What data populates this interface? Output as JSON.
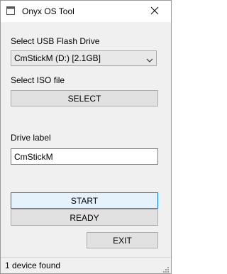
{
  "window": {
    "title": "Onyx OS Tool",
    "app_icon": "app-window-icon",
    "close_icon": "close-icon"
  },
  "usb": {
    "label": "Select USB Flash Drive",
    "selected": "CmStickM (D:) [2.1GB]",
    "arrow_icon": "chevron-down-icon"
  },
  "iso": {
    "label": "Select ISO file",
    "button_label": "SELECT"
  },
  "drive_label": {
    "label": "Drive label",
    "value": "CmStickM"
  },
  "actions": {
    "start_label": "START",
    "ready_label": "READY",
    "exit_label": "EXIT"
  },
  "status": {
    "text": "1 device found",
    "grip_icon": "resize-grip-icon"
  },
  "colors": {
    "focus_border": "#0078d7",
    "button_face": "#e1e1e1",
    "window_bg": "#f0f0f0"
  }
}
